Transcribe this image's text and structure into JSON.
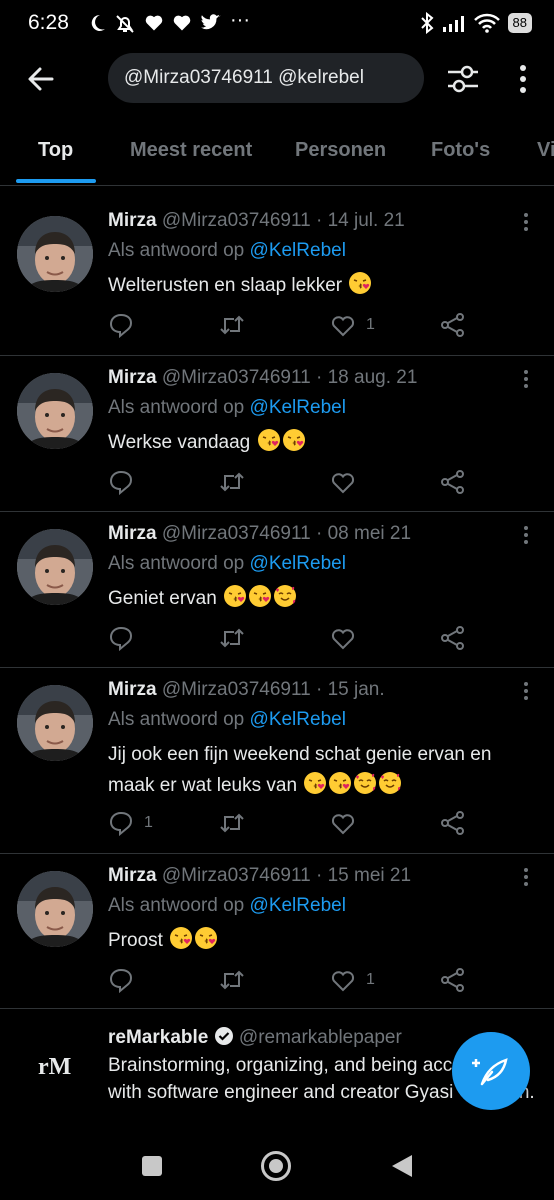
{
  "status": {
    "time": "6:28",
    "battery": "88"
  },
  "search": {
    "query": "@Mirza03746911 @kelrebel"
  },
  "tabs": [
    "Top",
    "Meest recent",
    "Personen",
    "Foto's",
    "Vi"
  ],
  "tweets": [
    {
      "name": "Mirza",
      "meta": "@Mirza03746911 · 14 jul. 21",
      "reply_prefix": "Als antwoord op",
      "reply_handle": "@KelRebel",
      "text": "Welterusten en slaap lekker",
      "emojis": [
        "kiss"
      ],
      "reply_count": "",
      "like_count": "1"
    },
    {
      "name": "Mirza",
      "meta": "@Mirza03746911 · 18 aug. 21",
      "reply_prefix": "Als antwoord op",
      "reply_handle": "@KelRebel",
      "text": "Werkse vandaag",
      "emojis": [
        "kiss",
        "kiss"
      ],
      "reply_count": "",
      "like_count": ""
    },
    {
      "name": "Mirza",
      "meta": "@Mirza03746911 · 08 mei 21",
      "reply_prefix": "Als antwoord op",
      "reply_handle": "@KelRebel",
      "text": "Geniet ervan",
      "emojis": [
        "kiss",
        "kiss",
        "hearts"
      ],
      "reply_count": "",
      "like_count": ""
    },
    {
      "name": "Mirza",
      "meta": "@Mirza03746911 · 15 jan.",
      "reply_prefix": "Als antwoord op",
      "reply_handle": "@KelRebel",
      "text": "Jij ook een fijn weekend schat genie ervan en maak er wat leuks van",
      "emojis": [
        "kiss",
        "kiss",
        "hearts",
        "hearts"
      ],
      "reply_count": "1",
      "like_count": ""
    },
    {
      "name": "Mirza",
      "meta": "@Mirza03746911 · 15 mei 21",
      "reply_prefix": "Als antwoord op",
      "reply_handle": "@KelRebel",
      "text": "Proost",
      "emojis": [
        "kiss",
        "kiss"
      ],
      "reply_count": "",
      "like_count": "1"
    }
  ],
  "ad": {
    "name": "reMarkable",
    "handle": "@remarkablepaper",
    "logo": "rM",
    "text": "Brainstorming, organizing, and being accountable with software engineer and creator Gyasi Calhoun."
  },
  "colors": {
    "accent": "#1d9bf0",
    "background": "#000000",
    "muted": "#71767b"
  },
  "icons": [
    "back-arrow-icon",
    "filter-icon",
    "more-vertical-icon",
    "reply-icon",
    "retweet-icon",
    "like-icon",
    "share-icon",
    "compose-icon",
    "verified-icon"
  ]
}
